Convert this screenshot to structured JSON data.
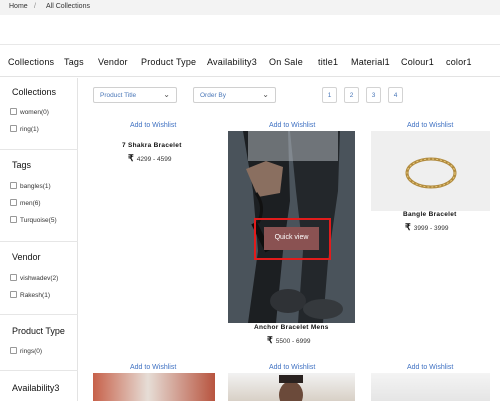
{
  "breadcrumb": {
    "home": "Home",
    "separator": "/",
    "current": "All Collections"
  },
  "filters": [
    "Collections",
    "Tags",
    "Vendor",
    "Product Type",
    "Availability3",
    "On Sale",
    "title1",
    "Material1",
    "Colour1",
    "color1"
  ],
  "sidebar": {
    "collections": {
      "title": "Collections",
      "options": [
        "women(0)",
        "ring(1)"
      ]
    },
    "tags": {
      "title": "Tags",
      "options": [
        "bangles(1)",
        "men(6)",
        "Turquoise(5)"
      ]
    },
    "vendor": {
      "title": "Vendor",
      "options": [
        "vishwadev(2)",
        "Rakesh(1)"
      ]
    },
    "product_type": {
      "title": "Product Type",
      "options": [
        "rings(0)"
      ]
    },
    "availability": {
      "title": "Availability3"
    }
  },
  "toolbar": {
    "sort_title": "Product Title",
    "order_by": "Order By",
    "pages": [
      "1",
      "2",
      "3",
      "4"
    ]
  },
  "icons": {
    "chevron": "chevron-down-icon",
    "checkbox": "checkbox-icon",
    "rupee": "rupee-icon"
  },
  "products": [
    {
      "wishlist": "Add to Wishlist",
      "name": "7 Shakra Bracelet",
      "currency": "₹",
      "price": "4299 - 4599"
    },
    {
      "wishlist": "Add to Wishlist",
      "name": "Anchor Bracelet Mens",
      "currency": "₹",
      "price": "5500 - 6999",
      "quick_view": "Quick view"
    },
    {
      "wishlist": "Add to Wishlist",
      "name": "Bangle Bracelet",
      "currency": "₹",
      "price": "3999 - 3999"
    }
  ],
  "row2": [
    {
      "wishlist": "Add to Wishlist"
    },
    {
      "wishlist": "Add to Wishlist"
    },
    {
      "wishlist": "Add to Wishlist"
    }
  ],
  "colors": {
    "link": "#3f71c2",
    "quick_view_bg": "#8a5252",
    "highlight": "#e11c1c"
  }
}
